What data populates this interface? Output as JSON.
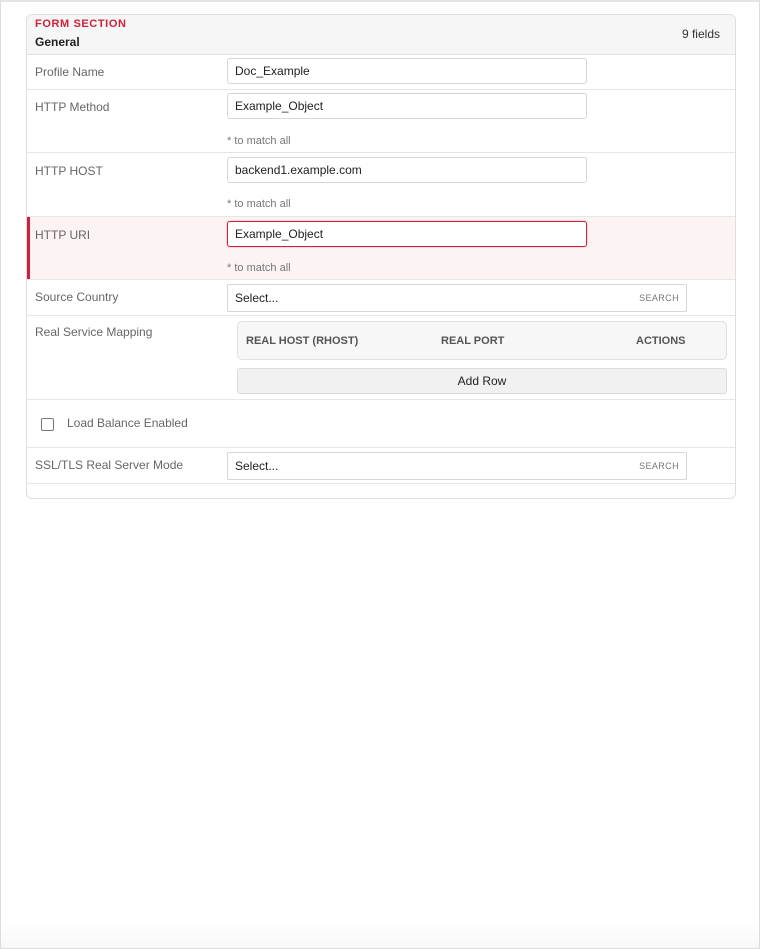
{
  "section": {
    "eyebrow": "FORM SECTION",
    "title": "General",
    "field_count": "9 fields"
  },
  "fields": {
    "profile_name": {
      "label": "Profile Name",
      "value": "Doc_Example"
    },
    "http_method": {
      "label": "HTTP Method",
      "value": "Example_Object",
      "hint": "* to match all"
    },
    "http_host": {
      "label": "HTTP HOST",
      "value": "backend1.example.com",
      "hint": "* to match all"
    },
    "http_uri": {
      "label": "HTTP URI",
      "value": "Example_Object",
      "hint": "* to match all"
    },
    "source_country": {
      "label": "Source Country",
      "selected": "Select...",
      "search_label": "SEARCH"
    },
    "real_service_mapping": {
      "label": "Real Service Mapping",
      "columns": [
        "REAL HOST (RHOST)",
        "REAL PORT",
        "ACTIONS"
      ],
      "add_row_label": "Add Row"
    },
    "load_balance": {
      "label": "Load Balance Enabled",
      "checked": false
    },
    "ssl_mode": {
      "label": "SSL/TLS Real Server Mode",
      "selected": "Select...",
      "search_label": "SEARCH"
    }
  },
  "colors": {
    "accent": "#d0213a",
    "highlight_bg": "#fcf3f4"
  }
}
